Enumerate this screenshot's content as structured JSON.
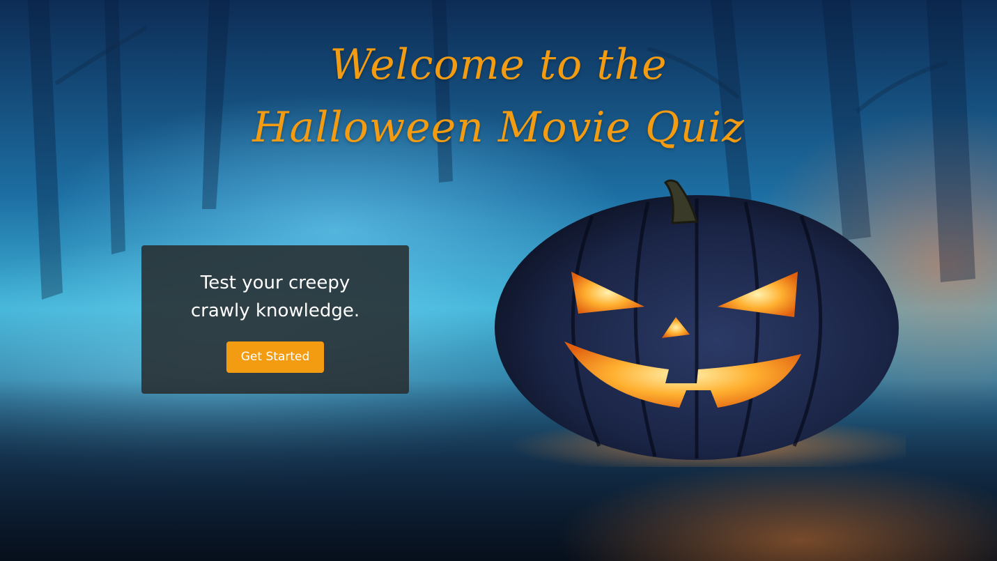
{
  "title": {
    "line1": "Welcome to the",
    "line2": "Halloween Movie Quiz"
  },
  "card": {
    "text": "Test your creepy crawly knowledge.",
    "button_label": "Get Started"
  },
  "colors": {
    "accent": "#f39c12",
    "card_background": "#2d3235",
    "text": "#ffffff"
  },
  "background": {
    "icon": "jack-o-lantern-icon"
  }
}
